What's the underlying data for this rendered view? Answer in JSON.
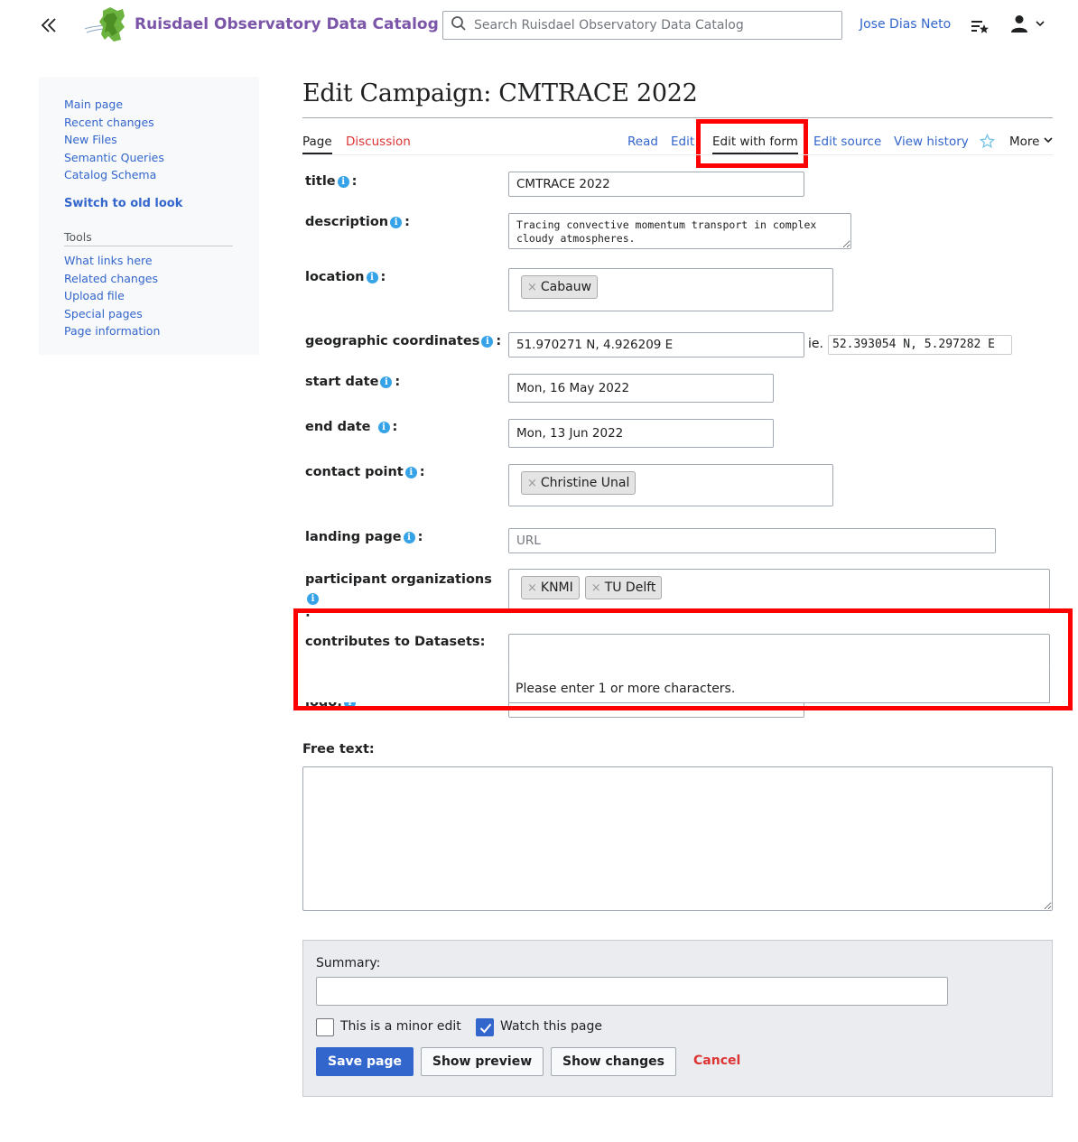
{
  "header": {
    "site_title": "Ruisdael Observatory Data Catalog",
    "search_placeholder": "Search Ruisdael Observatory Data Catalog",
    "user_name": "Jose Dias Neto"
  },
  "sidebar": {
    "nav_items": [
      "Main page",
      "Recent changes",
      "New Files",
      "Semantic Queries",
      "Catalog Schema"
    ],
    "switch_look": "Switch to old look",
    "tools_heading": "Tools",
    "tool_items": [
      "What links here",
      "Related changes",
      "Upload file",
      "Special pages",
      "Page information"
    ]
  },
  "page": {
    "title": "Edit Campaign: CMTRACE 2022",
    "tabs_left": [
      "Page",
      "Discussion"
    ],
    "tabs_right": [
      "Read",
      "Edit",
      "Edit with form",
      "Edit source",
      "View history"
    ],
    "more": "More"
  },
  "form": {
    "title_label": "title",
    "title_value": "CMTRACE 2022",
    "description_label": "description",
    "description_value": "Tracing convective momentum transport in complex cloudy atmospheres.",
    "location_label": "location",
    "location_tokens": [
      "Cabauw"
    ],
    "coords_label": "geographic coordinates",
    "coords_value": "51.970271 N, 4.926209 E",
    "coords_ie": "ie.",
    "coords_ie_value": "52.393054 N, 5.297282 E",
    "start_label": "start date",
    "start_value": "Mon, 16 May 2022",
    "end_label": "end date",
    "end_value": "Mon, 13 Jun 2022",
    "contact_label": "contact point",
    "contact_tokens": [
      "Christine Unal"
    ],
    "landing_label": "landing page",
    "landing_placeholder": "URL",
    "participants_label": "participant organizations",
    "participants_tokens": [
      "KNMI",
      "TU Delft"
    ],
    "contributes_label": "contributes to Datasets:",
    "contributes_hint": "Please enter 1 or more characters.",
    "logo_label": "logo:",
    "colon": ":",
    "freetext_label": "Free text:",
    "freetext_value": ""
  },
  "edit_options": {
    "summary_label": "Summary:",
    "summary_value": "",
    "minor_edit_label": "This is a minor edit",
    "minor_edit_checked": false,
    "watch_label": "Watch this page",
    "watch_checked": true,
    "save": "Save page",
    "preview": "Show preview",
    "changes": "Show changes",
    "cancel": "Cancel"
  },
  "colors": {
    "accent": "#3366cc",
    "title_purple": "#7b55a8",
    "highlight_red": "#ff0000",
    "danger": "#dd3333",
    "info_blue": "#36a3e8"
  }
}
